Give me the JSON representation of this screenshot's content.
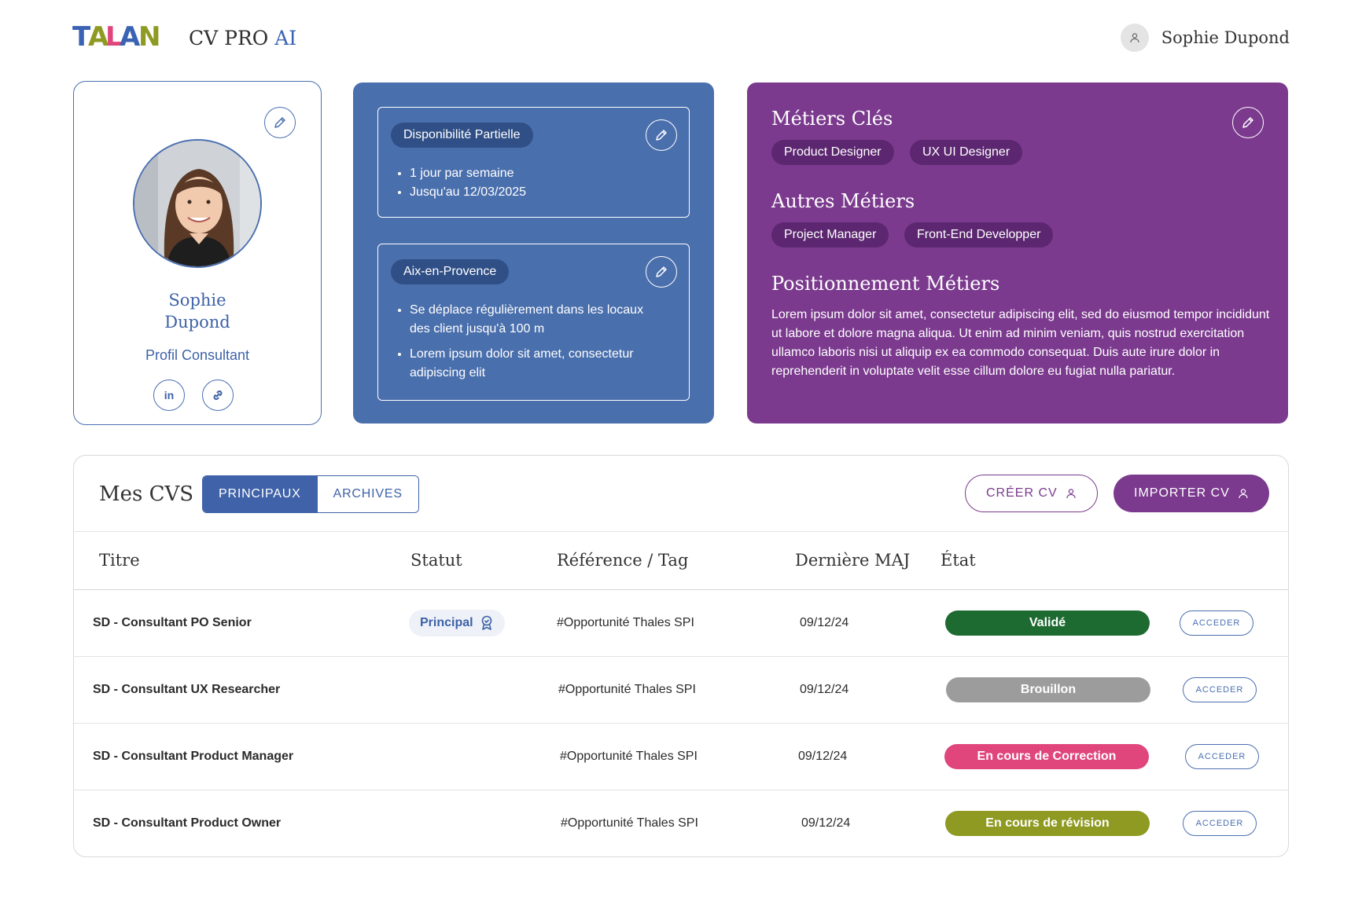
{
  "header": {
    "logo_text": "TALAN",
    "app_title": "CV PRO",
    "app_title_ai": "AI",
    "user_name": "Sophie Dupond"
  },
  "profile": {
    "first_name": "Sophie",
    "last_name": "Dupond",
    "role": "Profil Consultant",
    "linkedin_label": "in"
  },
  "availability": {
    "status": "Disponibilité Partielle",
    "items": [
      "1 jour par semaine",
      "Jusqu'au 12/03/2025"
    ]
  },
  "location": {
    "city": "Aix-en-Provence",
    "items": [
      "Se déplace régulièrement dans les locaux des client jusqu'à 100 m",
      "Lorem ipsum dolor sit amet, consectetur adipiscing elit"
    ]
  },
  "jobs": {
    "key_title": "Métiers Clés",
    "key": [
      "Product Designer",
      "UX UI Designer"
    ],
    "other_title": "Autres Métiers",
    "other": [
      "Project Manager",
      "Front-End Developper"
    ],
    "positioning_title": "Positionnement Métiers",
    "positioning_text": "Lorem ipsum dolor sit amet, consectetur adipiscing elit, sed do eiusmod tempor incididunt ut labore et dolore magna aliqua. Ut enim ad minim veniam, quis nostrud exercitation ullamco laboris nisi ut aliquip ex ea commodo consequat. Duis aute irure dolor in reprehenderit in voluptate velit esse cillum dolore eu fugiat nulla pariatur."
  },
  "cvs": {
    "title": "Mes CVS",
    "tabs": [
      "PRINCIPAUX",
      "ARCHIVES"
    ],
    "create_label": "CRÉER CV",
    "import_label": "IMPORTER CV",
    "columns": [
      "Titre",
      "Statut",
      "Référence / Tag",
      "Dernière MAJ",
      "État"
    ],
    "rows": [
      {
        "title": "SD - Consultant PO Senior",
        "status": "Principal",
        "ref": "#Opportunité Thales SPI",
        "date": "09/12/24",
        "state": "Validé",
        "state_color": "#1e6b32",
        "action": "ACCEDER"
      },
      {
        "title": "SD - Consultant UX Researcher",
        "status": "",
        "ref": "#Opportunité Thales SPI",
        "date": "09/12/24",
        "state": "Brouillon",
        "state_color": "#9c9c9c",
        "action": "ACCEDER"
      },
      {
        "title": "SD - Consultant Product Manager",
        "status": "",
        "ref": "#Opportunité Thales SPI",
        "date": "09/12/24",
        "state": "En cours de Correction",
        "state_color": "#e0457b",
        "action": "ACCEDER"
      },
      {
        "title": "SD - Consultant Product Owner",
        "status": "",
        "ref": "#Opportunité Thales SPI",
        "date": "09/12/24",
        "state": "En cours de révision",
        "state_color": "#8f9a22",
        "action": "ACCEDER"
      }
    ]
  },
  "colors": {
    "brand_blue": "#4a6fad",
    "brand_purple": "#7b3a8e",
    "logo_blue": "#3a63b3",
    "logo_pink": "#e0457b",
    "logo_olive": "#8f9a22"
  }
}
